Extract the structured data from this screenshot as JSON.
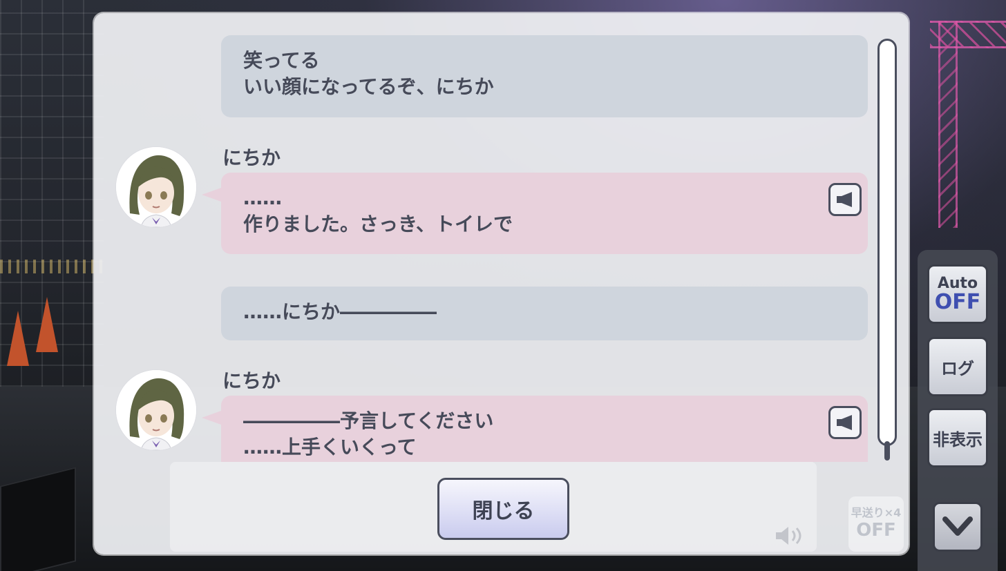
{
  "entries": [
    {
      "type": "narration",
      "lines": [
        "笑ってる",
        "いい顔になってるぞ、にちか"
      ]
    },
    {
      "type": "speech",
      "speaker": "にちか",
      "lines": [
        "……",
        "作りました。さっき、トイレで"
      ],
      "voice_icon": "speaker-icon"
    },
    {
      "type": "narration",
      "lines": [
        "……にちか―――――"
      ]
    },
    {
      "type": "speech",
      "speaker": "にちか",
      "lines": [
        "―――――予言してください",
        "……上手くいくって"
      ],
      "voice_icon": "speaker-icon"
    }
  ],
  "close_label": "閉じる",
  "side_panel": {
    "auto_label": "Auto",
    "auto_state": "OFF",
    "log_label": "ログ",
    "hide_label": "非表示",
    "down_icon": "chevron-down-icon"
  },
  "background_hud": {
    "fast_forward_label": "早送り×4",
    "fast_forward_state": "OFF"
  },
  "colors": {
    "narration_bubble": "#cfd5dd",
    "speech_bubble": "#e8d1dc",
    "text": "#464a59",
    "auto_off": "#3f4fb0"
  }
}
